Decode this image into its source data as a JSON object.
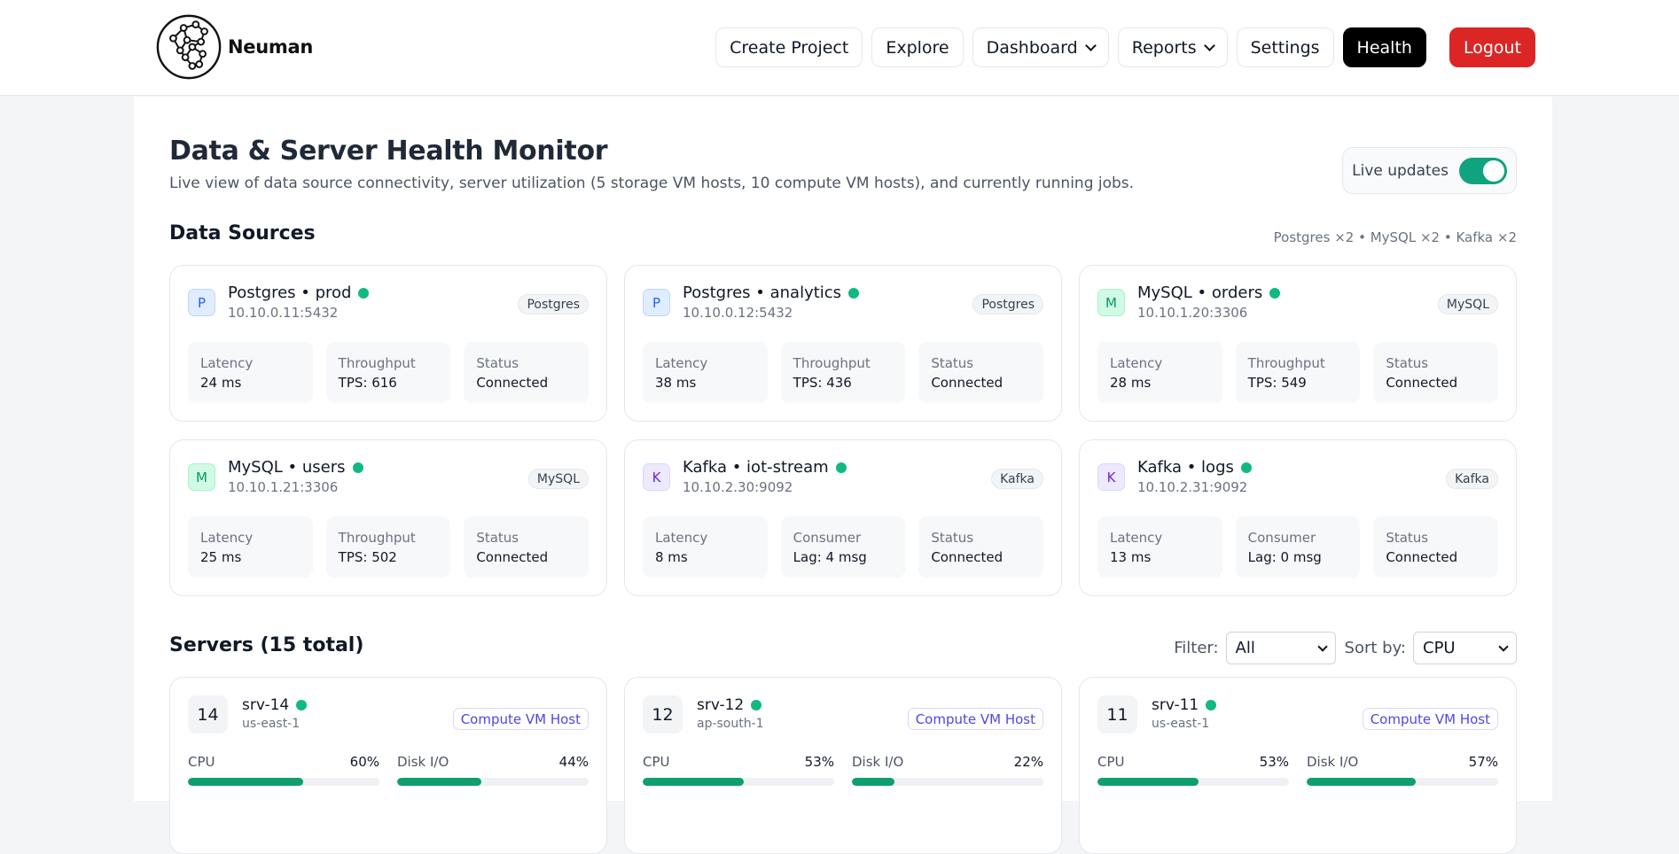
{
  "brand": {
    "name": "Neuman"
  },
  "nav": {
    "create_project": "Create Project",
    "explore": "Explore",
    "dashboard": "Dashboard",
    "reports": "Reports",
    "settings": "Settings",
    "health": "Health",
    "logout": "Logout"
  },
  "header": {
    "title": "Data & Server Health Monitor",
    "subtitle": "Live view of data source connectivity, server utilization (5 storage VM hosts, 10 compute VM hosts), and currently running jobs.",
    "live_label": "Live updates",
    "live_on": true
  },
  "data_sources": {
    "title": "Data Sources",
    "summary": "Postgres ×2 • MySQL ×2 • Kafka ×2",
    "items": [
      {
        "icon": "P",
        "kind": "pg",
        "name": "Postgres • prod",
        "host": "10.10.0.11:5432",
        "type": "Postgres",
        "m1_label": "Latency",
        "m1_value": "24 ms",
        "m2_label": "Throughput",
        "m2_value": "TPS: 616",
        "m3_label": "Status",
        "m3_value": "Connected"
      },
      {
        "icon": "P",
        "kind": "pg",
        "name": "Postgres • analytics",
        "host": "10.10.0.12:5432",
        "type": "Postgres",
        "m1_label": "Latency",
        "m1_value": "38 ms",
        "m2_label": "Throughput",
        "m2_value": "TPS: 436",
        "m3_label": "Status",
        "m3_value": "Connected"
      },
      {
        "icon": "M",
        "kind": "my",
        "name": "MySQL • orders",
        "host": "10.10.1.20:3306",
        "type": "MySQL",
        "m1_label": "Latency",
        "m1_value": "28 ms",
        "m2_label": "Throughput",
        "m2_value": "TPS: 549",
        "m3_label": "Status",
        "m3_value": "Connected"
      },
      {
        "icon": "M",
        "kind": "my",
        "name": "MySQL • users",
        "host": "10.10.1.21:3306",
        "type": "MySQL",
        "m1_label": "Latency",
        "m1_value": "25 ms",
        "m2_label": "Throughput",
        "m2_value": "TPS: 502",
        "m3_label": "Status",
        "m3_value": "Connected"
      },
      {
        "icon": "K",
        "kind": "kf",
        "name": "Kafka • iot-stream",
        "host": "10.10.2.30:9092",
        "type": "Kafka",
        "m1_label": "Latency",
        "m1_value": "8 ms",
        "m2_label": "Consumer",
        "m2_value": "Lag: 4 msg",
        "m3_label": "Status",
        "m3_value": "Connected"
      },
      {
        "icon": "K",
        "kind": "kf",
        "name": "Kafka • logs",
        "host": "10.10.2.31:9092",
        "type": "Kafka",
        "m1_label": "Latency",
        "m1_value": "13 ms",
        "m2_label": "Consumer",
        "m2_value": "Lag: 0 msg",
        "m3_label": "Status",
        "m3_value": "Connected"
      }
    ]
  },
  "servers": {
    "title": "Servers (15 total)",
    "filter_label": "Filter:",
    "filter_value": "All",
    "sort_label": "Sort by:",
    "sort_value": "CPU",
    "items": [
      {
        "num": "14",
        "name": "srv-14",
        "region": "us-east-1",
        "role": "Compute VM Host",
        "cpu_label": "CPU",
        "cpu": "60%",
        "cpu_frac": 0.6,
        "disk_label": "Disk I/O",
        "disk": "44%",
        "disk_frac": 0.44
      },
      {
        "num": "12",
        "name": "srv-12",
        "region": "ap-south-1",
        "role": "Compute VM Host",
        "cpu_label": "CPU",
        "cpu": "53%",
        "cpu_frac": 0.53,
        "disk_label": "Disk I/O",
        "disk": "22%",
        "disk_frac": 0.22
      },
      {
        "num": "11",
        "name": "srv-11",
        "region": "us-east-1",
        "role": "Compute VM Host",
        "cpu_label": "CPU",
        "cpu": "53%",
        "cpu_frac": 0.53,
        "disk_label": "Disk I/O",
        "disk": "57%",
        "disk_frac": 0.57
      }
    ]
  },
  "colors": {
    "accent_green": "#10b981",
    "danger": "#dc2626",
    "toggle_on": "#10a37f"
  }
}
